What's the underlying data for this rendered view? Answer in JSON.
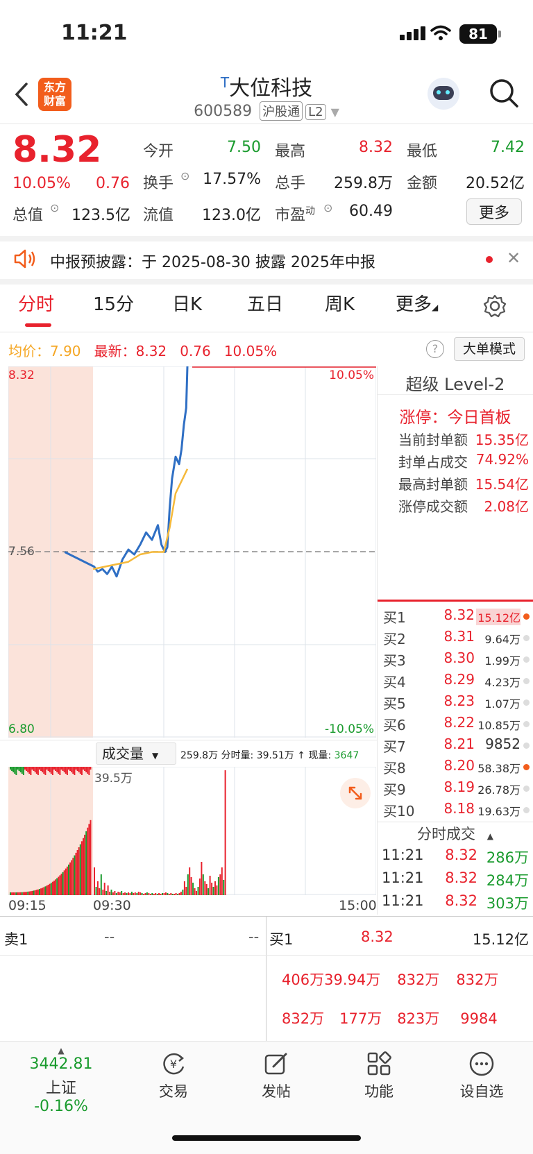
{
  "status": {
    "time": "11:21",
    "battery": "81"
  },
  "header": {
    "logo": "东方财富",
    "stock_prefix": "T",
    "stock_name": "大位科技",
    "stock_code": "600589",
    "tag_hgt": "沪股通",
    "tag_level": "L2"
  },
  "quote": {
    "price": "8.32",
    "change_pct": "10.05%",
    "change": "0.76",
    "open_label": "今开",
    "open": "7.50",
    "high_label": "最高",
    "high": "8.32",
    "low_label": "最低",
    "low": "7.42",
    "turnover_label": "换手",
    "turnover": "17.57%",
    "volume_label": "总手",
    "volume": "259.8万",
    "amount_label": "金额",
    "amount": "20.52亿",
    "mktcap_label": "总值",
    "mktcap": "123.5亿",
    "float_label": "流值",
    "float": "123.0亿",
    "pe_label": "市盈",
    "pe_sup": "动",
    "pe": "60.49",
    "more_button": "更多"
  },
  "notice": {
    "text": "中报预披露：于 2025-08-30 披露 2025年中报"
  },
  "tabs": [
    "分时",
    "15分",
    "日K",
    "五日",
    "周K",
    "更多"
  ],
  "chart_info": {
    "avg_label": "均价：",
    "avg": "7.90",
    "latest_label": "最新：",
    "latest": "8.32",
    "change": "0.76",
    "pct": "10.05%",
    "mode_button": "大单模式"
  },
  "chart_data": {
    "type": "line",
    "y_top": "8.32",
    "y_mid": "7.56",
    "y_bottom": "6.80",
    "pct_top": "10.05%",
    "pct_bottom": "-10.05%",
    "ylim": [
      6.8,
      8.32
    ],
    "series": [
      {
        "name": "price",
        "color": "#2f6fc4",
        "x": [
          "09:25",
          "09:31",
          "09:34",
          "09:38",
          "09:42",
          "09:46",
          "09:50",
          "09:55",
          "10:00",
          "10:05",
          "10:10",
          "10:15",
          "10:20",
          "10:25",
          "10:28",
          "10:31",
          "10:33",
          "10:35",
          "10:37",
          "10:40",
          "10:43",
          "10:45",
          "10:47",
          "10:49",
          "10:50"
        ],
        "values": [
          7.56,
          7.5,
          7.48,
          7.49,
          7.47,
          7.5,
          7.46,
          7.53,
          7.57,
          7.55,
          7.59,
          7.64,
          7.61,
          7.67,
          7.59,
          7.56,
          7.58,
          7.74,
          7.86,
          7.95,
          7.92,
          7.98,
          8.08,
          8.15,
          8.32
        ]
      },
      {
        "name": "avg",
        "color": "#f5b93a",
        "x": [
          "09:30",
          "09:40",
          "09:50",
          "10:00",
          "10:10",
          "10:20",
          "10:30",
          "10:35",
          "10:40",
          "10:45",
          "10:50"
        ],
        "values": [
          7.49,
          7.5,
          7.51,
          7.52,
          7.55,
          7.56,
          7.56,
          7.66,
          7.8,
          7.85,
          7.9
        ]
      }
    ],
    "time_labels": [
      "09:15",
      "09:30",
      "15:00"
    ]
  },
  "volume": {
    "selector": "成交量",
    "total": "259.8万",
    "period_label": "分时量:",
    "period": "39.51万",
    "now_label": "现量:",
    "now": "3647",
    "max_label": "39.5万"
  },
  "level2": {
    "title": "超级 Level-2",
    "limit_title": "涨停：今日首板",
    "rows": [
      {
        "label": "当前封单额",
        "value": "15.35亿"
      },
      {
        "label": "封单占成交",
        "value": "74.92%"
      },
      {
        "label": "最高封单额",
        "value": "15.54亿"
      },
      {
        "label": "涨停成交额",
        "value": "2.08亿"
      }
    ]
  },
  "orderbook": [
    {
      "label": "买1",
      "price": "8.32",
      "vol": "15.12亿",
      "active": true
    },
    {
      "label": "买2",
      "price": "8.31",
      "vol": "9.64万",
      "active": false
    },
    {
      "label": "买3",
      "price": "8.30",
      "vol": "1.99万",
      "active": false
    },
    {
      "label": "买4",
      "price": "8.29",
      "vol": "4.23万",
      "active": false
    },
    {
      "label": "买5",
      "price": "8.23",
      "vol": "1.07万",
      "active": false
    },
    {
      "label": "买6",
      "price": "8.22",
      "vol": "10.85万",
      "active": false
    },
    {
      "label": "买7",
      "price": "8.21",
      "vol": "9852",
      "active": false
    },
    {
      "label": "买8",
      "price": "8.20",
      "vol": "58.38万",
      "active": true
    },
    {
      "label": "买9",
      "price": "8.19",
      "vol": "26.78万",
      "active": false
    },
    {
      "label": "买10",
      "price": "8.18",
      "vol": "19.63万",
      "active": false
    }
  ],
  "trades": {
    "title": "分时成交",
    "rows": [
      {
        "time": "11:21",
        "price": "8.32",
        "vol": "286万"
      },
      {
        "time": "11:21",
        "price": "8.32",
        "vol": "284万"
      },
      {
        "time": "11:21",
        "price": "8.32",
        "vol": "303万"
      }
    ]
  },
  "bottom_table": {
    "sell_label": "卖1",
    "sell_a": "--",
    "sell_b": "--",
    "buy_label": "买1",
    "buy_price": "8.32",
    "buy_vol": "15.12亿",
    "row2": [
      "406万",
      "39.94万",
      "832万",
      "832万"
    ],
    "row3": [
      "832万",
      "177万",
      "823万",
      "9984"
    ]
  },
  "nav": {
    "index_value": "3442.81",
    "index_name": "上证",
    "index_change": "-0.16%",
    "items": [
      "交易",
      "发帖",
      "功能",
      "设自选"
    ]
  }
}
